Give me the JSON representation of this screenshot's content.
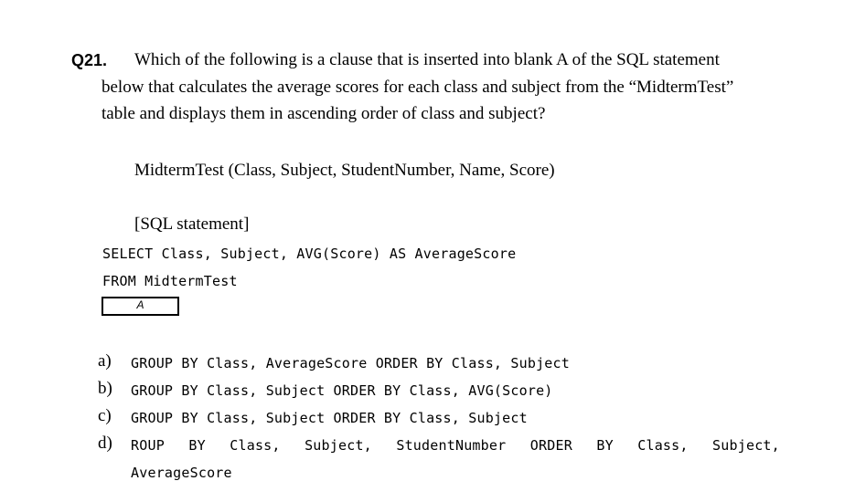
{
  "question": {
    "number": "Q21.",
    "line1": "Which of the following is a clause that is inserted into blank A of the SQL statement",
    "line2": "below that calculates the average scores for each class and subject from the “MidtermTest”",
    "line3": "table and displays them in ascending order of class and subject?"
  },
  "table_definition": "MidtermTest (Class, Subject, StudentNumber, Name, Score)",
  "sql": {
    "heading": "[SQL statement]",
    "select_line": "SELECT Class, Subject, AVG(Score) AS AverageScore",
    "from_line": "FROM MidtermTest",
    "blank_label": "A"
  },
  "options": {
    "a": {
      "letter": "a)",
      "text": "GROUP BY Class, AverageScore ORDER BY Class, Subject"
    },
    "b": {
      "letter": "b)",
      "text": "GROUP BY Class, Subject ORDER BY Class, AVG(Score)"
    },
    "c": {
      "letter": "c)",
      "text": "GROUP BY Class, Subject ORDER BY Class, Subject"
    },
    "d": {
      "letter": "d)",
      "words": [
        "ROUP",
        "BY",
        "Class,",
        "Subject,",
        "StudentNumber",
        "ORDER",
        "BY",
        "Class,",
        "Subject,"
      ],
      "continuation": "AverageScore"
    }
  }
}
